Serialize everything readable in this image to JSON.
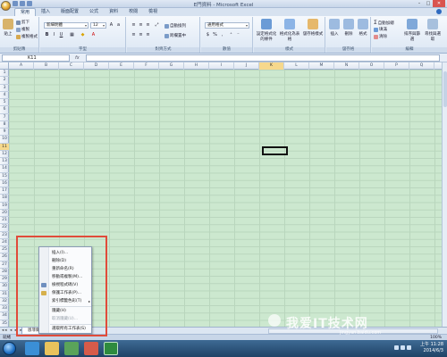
{
  "window": {
    "title": "E門資料 - Microsoft Excel",
    "controls": {
      "minimize": "–",
      "maximize": "□",
      "close": "✕"
    }
  },
  "ribbon_tabs": [
    "常用",
    "插入",
    "版面配置",
    "公式",
    "資料",
    "校閱",
    "檢視"
  ],
  "ribbon": {
    "clipboard": {
      "label": "剪貼簿",
      "paste": "貼上",
      "cut": "剪下",
      "copy": "複製",
      "format_painter": "複製格式"
    },
    "font": {
      "label": "字型",
      "name": "新細明體",
      "size": "12"
    },
    "alignment": {
      "label": "對齊方式",
      "wrap": "自動換列",
      "merge": "跨欄置中"
    },
    "number": {
      "label": "數值",
      "format": "通用格式"
    },
    "styles": {
      "label": "樣式",
      "conditional": "設定格式化的條件",
      "as_table": "格式化為表格",
      "cell_styles": "儲存格樣式"
    },
    "cells": {
      "label": "儲存格",
      "insert": "插入",
      "delete": "刪除",
      "format": "格式"
    },
    "editing": {
      "label": "編輯",
      "autosum": "自動加總",
      "fill": "填滿",
      "clear": "清除",
      "sort": "排序與篩選",
      "find": "尋找與選取"
    }
  },
  "formula_bar": {
    "name_box": "K11",
    "fx": "fx",
    "value": ""
  },
  "columns": [
    "A",
    "B",
    "C",
    "D",
    "E",
    "F",
    "G",
    "H",
    "I",
    "J",
    "K",
    "L",
    "M",
    "N",
    "O",
    "P",
    "Q"
  ],
  "selected_column": "K",
  "rows": [
    "1",
    "2",
    "3",
    "4",
    "5",
    "6",
    "7",
    "8",
    "9",
    "10",
    "11",
    "12",
    "13",
    "14",
    "15",
    "16",
    "17",
    "18",
    "19",
    "20",
    "21",
    "22",
    "23",
    "24",
    "25",
    "26",
    "27",
    "28",
    "29",
    "30",
    "31",
    "32",
    "33",
    "34",
    "35"
  ],
  "selected_row": "11",
  "context_menu": {
    "items": [
      {
        "label": "插入(I)...",
        "disabled": false
      },
      {
        "label": "刪除(D)",
        "disabled": false
      },
      {
        "label": "重新命名(R)",
        "disabled": false
      },
      {
        "label": "移動或複製(M)...",
        "disabled": false
      },
      {
        "label": "檢視程式碼(V)",
        "disabled": false
      },
      {
        "label": "保護工作表(P)...",
        "disabled": false
      },
      {
        "label": "索引標籤色彩(T)",
        "disabled": false,
        "submenu": "▸"
      },
      {
        "label": "隱藏(H)",
        "disabled": false
      },
      {
        "label": "取消隱藏(U)...",
        "disabled": true
      },
      {
        "label": "選取所有工作表(S)",
        "disabled": false
      }
    ]
  },
  "sheet_tabs": {
    "nav": "◂◂ ◂ ▸ ▸▸",
    "active": "恩菲爾"
  },
  "status": {
    "ready": "就緒",
    "zoom": "100%"
  },
  "taskbar": {
    "time": "上午 11:28",
    "date": "2014/6/3"
  },
  "watermark": {
    "main": "我爱IT技术网",
    "sub": "jingyan.baidu.com"
  },
  "colors": {
    "grid": "#cce8cf",
    "highlight": "#f6d88c",
    "annotation": "#e04b3a"
  }
}
